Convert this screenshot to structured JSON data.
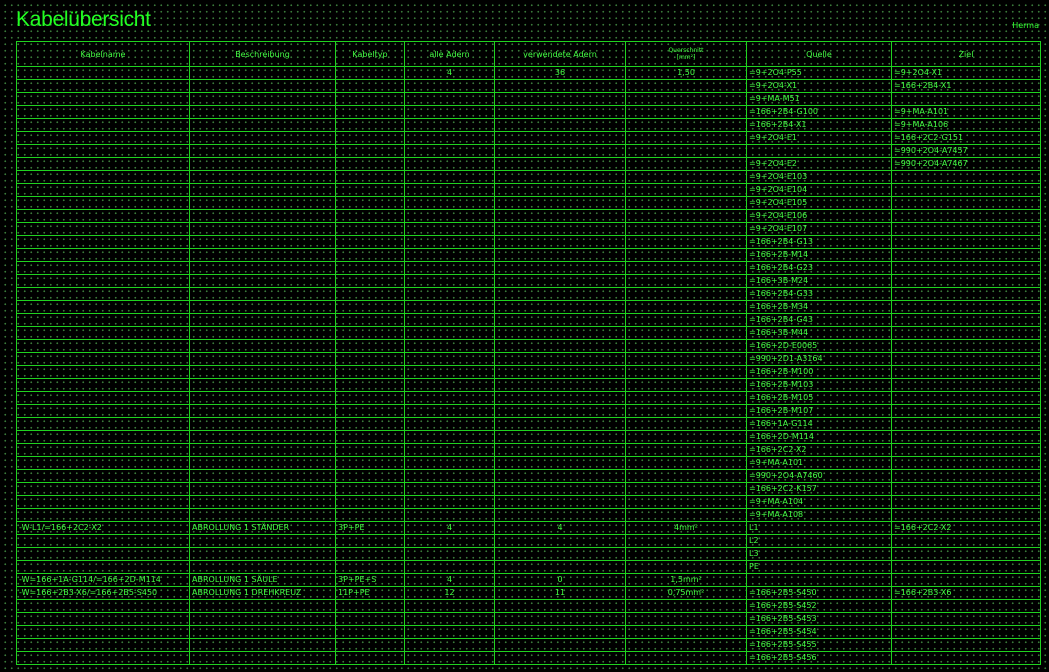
{
  "title": "Kabelübersicht",
  "author": "Herma",
  "headers": {
    "name": "Kabelname",
    "description": "Beschreibung",
    "type": "Kabeltyp",
    "all_cores": "alle Adern",
    "used_cores": "verwendete Adern",
    "cross_section": "Querschnitt",
    "cross_section_unit": "[mm²]",
    "source": "Quelle",
    "target": "Ziel"
  },
  "rows": [
    {
      "name": "",
      "desc": "",
      "type": "",
      "all": "4",
      "used": "36",
      "cs": "1,50",
      "src": "=9+2O4-P55",
      "dst": "=9+2O4-X1"
    },
    {
      "name": "",
      "desc": "",
      "type": "",
      "all": "",
      "used": "",
      "cs": "",
      "src": "=9+2O4-X1",
      "dst": "=166+2B4-X1"
    },
    {
      "name": "",
      "desc": "",
      "type": "",
      "all": "",
      "used": "",
      "cs": "",
      "src": "=9+MA-M51",
      "dst": ""
    },
    {
      "name": "",
      "desc": "",
      "type": "",
      "all": "",
      "used": "",
      "cs": "",
      "src": "=166+2B4-G100",
      "dst": "=9+MA-A101"
    },
    {
      "name": "",
      "desc": "",
      "type": "",
      "all": "",
      "used": "",
      "cs": "",
      "src": "=166+2B4-X1",
      "dst": "=9+MA-A106"
    },
    {
      "name": "",
      "desc": "",
      "type": "",
      "all": "",
      "used": "",
      "cs": "",
      "src": "=9+2O4-E1",
      "dst": "=166+2C2-G151"
    },
    {
      "name": "",
      "desc": "",
      "type": "",
      "all": "",
      "used": "",
      "cs": "",
      "src": "",
      "dst": "=990+2O4-A7457"
    },
    {
      "name": "",
      "desc": "",
      "type": "",
      "all": "",
      "used": "",
      "cs": "",
      "src": "=9+2O4-E2",
      "dst": "=990+2O4-A7467"
    },
    {
      "name": "",
      "desc": "",
      "type": "",
      "all": "",
      "used": "",
      "cs": "",
      "src": "=9+2O4-E103",
      "dst": ""
    },
    {
      "name": "",
      "desc": "",
      "type": "",
      "all": "",
      "used": "",
      "cs": "",
      "src": "=9+2O4-E104",
      "dst": ""
    },
    {
      "name": "",
      "desc": "",
      "type": "",
      "all": "",
      "used": "",
      "cs": "",
      "src": "=9+2O4-E105",
      "dst": ""
    },
    {
      "name": "",
      "desc": "",
      "type": "",
      "all": "",
      "used": "",
      "cs": "",
      "src": "=9+2O4-E106",
      "dst": ""
    },
    {
      "name": "",
      "desc": "",
      "type": "",
      "all": "",
      "used": "",
      "cs": "",
      "src": "=9+2O4-E107",
      "dst": ""
    },
    {
      "name": "",
      "desc": "",
      "type": "",
      "all": "",
      "used": "",
      "cs": "",
      "src": "=166+2B4-G13",
      "dst": ""
    },
    {
      "name": "",
      "desc": "",
      "type": "",
      "all": "",
      "used": "",
      "cs": "",
      "src": "=166+2B-M14",
      "dst": ""
    },
    {
      "name": "",
      "desc": "",
      "type": "",
      "all": "",
      "used": "",
      "cs": "",
      "src": "=166+2B4-G23",
      "dst": ""
    },
    {
      "name": "",
      "desc": "",
      "type": "",
      "all": "",
      "used": "",
      "cs": "",
      "src": "=166+3B-M24",
      "dst": ""
    },
    {
      "name": "",
      "desc": "",
      "type": "",
      "all": "",
      "used": "",
      "cs": "",
      "src": "=166+2B4-G33",
      "dst": ""
    },
    {
      "name": "",
      "desc": "",
      "type": "",
      "all": "",
      "used": "",
      "cs": "",
      "src": "=166+2B-M34",
      "dst": ""
    },
    {
      "name": "",
      "desc": "",
      "type": "",
      "all": "",
      "used": "",
      "cs": "",
      "src": "=166+2B4-G43",
      "dst": ""
    },
    {
      "name": "",
      "desc": "",
      "type": "",
      "all": "",
      "used": "",
      "cs": "",
      "src": "=166+3B-M44",
      "dst": ""
    },
    {
      "name": "",
      "desc": "",
      "type": "",
      "all": "",
      "used": "",
      "cs": "",
      "src": "=166+2D-E0065",
      "dst": ""
    },
    {
      "name": "",
      "desc": "",
      "type": "",
      "all": "",
      "used": "",
      "cs": "",
      "src": "=990+2D1-A3164",
      "dst": ""
    },
    {
      "name": "",
      "desc": "",
      "type": "",
      "all": "",
      "used": "",
      "cs": "",
      "src": "=166+2B-M100",
      "dst": ""
    },
    {
      "name": "",
      "desc": "",
      "type": "",
      "all": "",
      "used": "",
      "cs": "",
      "src": "=166+2B-M103",
      "dst": ""
    },
    {
      "name": "",
      "desc": "",
      "type": "",
      "all": "",
      "used": "",
      "cs": "",
      "src": "=166+2B-M105",
      "dst": ""
    },
    {
      "name": "",
      "desc": "",
      "type": "",
      "all": "",
      "used": "",
      "cs": "",
      "src": "=166+2B-M107",
      "dst": ""
    },
    {
      "name": "",
      "desc": "",
      "type": "",
      "all": "",
      "used": "",
      "cs": "",
      "src": "=166+1A-G114",
      "dst": ""
    },
    {
      "name": "",
      "desc": "",
      "type": "",
      "all": "",
      "used": "",
      "cs": "",
      "src": "=166+2D-M114",
      "dst": ""
    },
    {
      "name": "",
      "desc": "",
      "type": "",
      "all": "",
      "used": "",
      "cs": "",
      "src": "=166+2C2-X2",
      "dst": ""
    },
    {
      "name": "",
      "desc": "",
      "type": "",
      "all": "",
      "used": "",
      "cs": "",
      "src": "=9+MA-A101",
      "dst": ""
    },
    {
      "name": "",
      "desc": "",
      "type": "",
      "all": "",
      "used": "",
      "cs": "",
      "src": "=990+2O4-A7460",
      "dst": ""
    },
    {
      "name": "",
      "desc": "",
      "type": "",
      "all": "",
      "used": "",
      "cs": "",
      "src": "=166+2C2-K157",
      "dst": ""
    },
    {
      "name": "",
      "desc": "",
      "type": "",
      "all": "",
      "used": "",
      "cs": "",
      "src": "=9+MA-A104",
      "dst": ""
    },
    {
      "name": "",
      "desc": "",
      "type": "",
      "all": "",
      "used": "",
      "cs": "",
      "src": "=9+MA-A108",
      "dst": ""
    },
    {
      "name": "-W-L1/=166+2C2-X2",
      "desc": "ABROLLUNG 1 STÄNDER",
      "type": "3P+PE",
      "all": "4",
      "used": "4",
      "cs": "4mm²",
      "src": "L1",
      "dst": "=166+2C2-X2"
    },
    {
      "name": "",
      "desc": "",
      "type": "",
      "all": "",
      "used": "",
      "cs": "",
      "src": "L2",
      "dst": ""
    },
    {
      "name": "",
      "desc": "",
      "type": "",
      "all": "",
      "used": "",
      "cs": "",
      "src": "L3",
      "dst": ""
    },
    {
      "name": "",
      "desc": "",
      "type": "",
      "all": "",
      "used": "",
      "cs": "",
      "src": "PE",
      "dst": ""
    },
    {
      "name": "-W=166+1A-G114/=166+2D-M114",
      "desc": "ABROLLUNG 1 SÄULE",
      "type": "3P+PE+S",
      "all": "4",
      "used": "0",
      "cs": "1,5mm²",
      "src": "",
      "dst": ""
    },
    {
      "name": "-W=166+2B3-X6/=166+2B5-S450",
      "desc": "ABROLLUNG 1 DREHKREUZ",
      "type": "11P+PE",
      "all": "12",
      "used": "11",
      "cs": "0,75mm²",
      "src": "=166+2B5-S450",
      "dst": "=166+2B3-X6"
    },
    {
      "name": "",
      "desc": "",
      "type": "",
      "all": "",
      "used": "",
      "cs": "",
      "src": "=166+2B5-S452",
      "dst": ""
    },
    {
      "name": "",
      "desc": "",
      "type": "",
      "all": "",
      "used": "",
      "cs": "",
      "src": "=166+2B5-S453",
      "dst": ""
    },
    {
      "name": "",
      "desc": "",
      "type": "",
      "all": "",
      "used": "",
      "cs": "",
      "src": "=166+2B5-S454",
      "dst": ""
    },
    {
      "name": "",
      "desc": "",
      "type": "",
      "all": "",
      "used": "",
      "cs": "",
      "src": "=166+2B5-S455",
      "dst": ""
    },
    {
      "name": "",
      "desc": "",
      "type": "",
      "all": "",
      "used": "",
      "cs": "",
      "src": "=166+2B5-S456",
      "dst": ""
    }
  ]
}
